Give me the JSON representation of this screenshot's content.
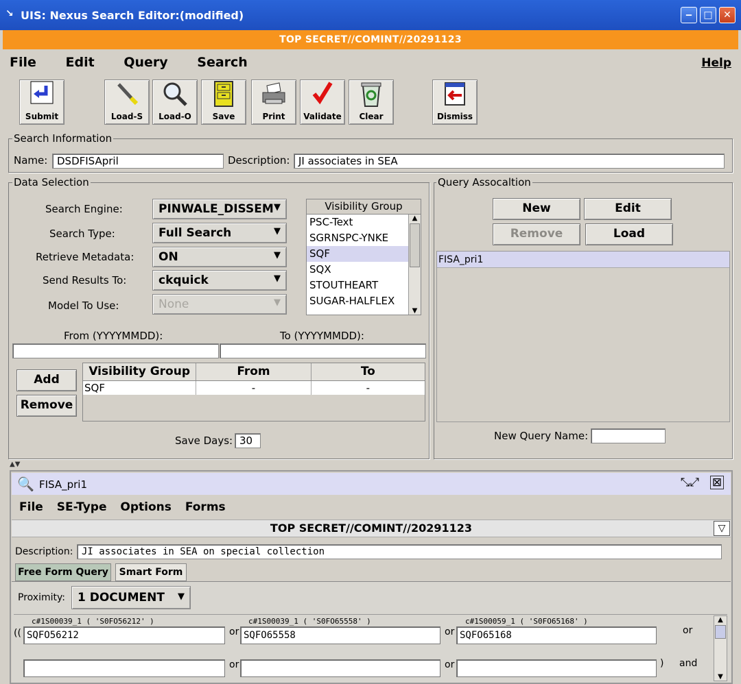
{
  "window": {
    "title": "UIS: Nexus Search Editor:(modified)",
    "classification": "TOP SECRET//COMINT//20291123",
    "minimize_glyph": "‒",
    "maximize_glyph": "□",
    "close_glyph": "✕"
  },
  "menu": {
    "file": "File",
    "edit": "Edit",
    "query": "Query",
    "search": "Search",
    "help": "Help"
  },
  "toolbar": {
    "submit": "Submit",
    "load_s": "Load-S",
    "load_o": "Load-O",
    "save": "Save",
    "print": "Print",
    "validate": "Validate",
    "clear": "Clear",
    "dismiss": "Dismiss"
  },
  "search_info": {
    "title": "Search Information",
    "name_label": "Name:",
    "name_value": "DSDFISApril",
    "description_label": "Description:",
    "description_value": "JI associates in SEA"
  },
  "data_selection": {
    "title": "Data Selection",
    "search_engine_label": "Search Engine:",
    "search_engine": "PINWALE_DISSEM",
    "search_type_label": "Search Type:",
    "search_type": "Full Search",
    "retrieve_metadata_label": "Retrieve Metadata:",
    "retrieve_metadata": "ON",
    "send_results_label": "Send Results To:",
    "send_results": "ckquick",
    "model_label": "Model To Use:",
    "model": "None",
    "visibility_group_header": "Visibility Group",
    "visibility_groups": [
      "PSC-Text",
      "SGRNSPC-YNKE",
      "SQF",
      "SQX",
      "STOUTHEART",
      "SUGAR-HALFLEX"
    ],
    "from_label": "From (YYYYMMDD):",
    "to_label": "To (YYYYMMDD):",
    "add_button": "Add",
    "remove_button": "Remove",
    "table_headers": [
      "Visibility Group",
      "From",
      "To"
    ],
    "table_rows": [
      [
        "SQF",
        "-",
        "-"
      ]
    ],
    "save_days_label": "Save Days:",
    "save_days": "30"
  },
  "query_association": {
    "title": "Query Assocaltion",
    "new_button": "New",
    "edit_button": "Edit",
    "remove_button": "Remove",
    "load_button": "Load",
    "items": [
      "FISA_pri1"
    ],
    "new_query_label": "New Query Name:"
  },
  "subwindow": {
    "title": "FISA_pri1",
    "menu": [
      "File",
      "SE-Type",
      "Options",
      "Forms"
    ],
    "classification": "TOP SECRET//COMINT//20291123",
    "description_label": "Description:",
    "description_value": "JI associates in SEA on special collection",
    "tabs": [
      "Free Form Query",
      "Smart Form"
    ],
    "proximity_label": "Proximity:",
    "proximity_value": "1 DOCUMENT",
    "row1": {
      "labels": [
        "c#1S00039_1 ( 'S0FO56212' )",
        "c#1S00039_1 ( 'S0FO65558' )",
        "c#1S00059_1 ( 'S0FO65168' )"
      ],
      "values": [
        "SQFO56212",
        "SQFO65558",
        "SQFO65168"
      ],
      "open_paren": "((",
      "sep1": "or",
      "sep2": "or",
      "end": "or"
    },
    "row2": {
      "sep1": "or",
      "sep2": "or",
      "close_paren": ")",
      "end": "and"
    }
  },
  "colors": {
    "titlebar": "#2a64d8",
    "classbar": "#f7941d",
    "panel": "#d4d0c8",
    "selection": "#d6d6f0"
  }
}
